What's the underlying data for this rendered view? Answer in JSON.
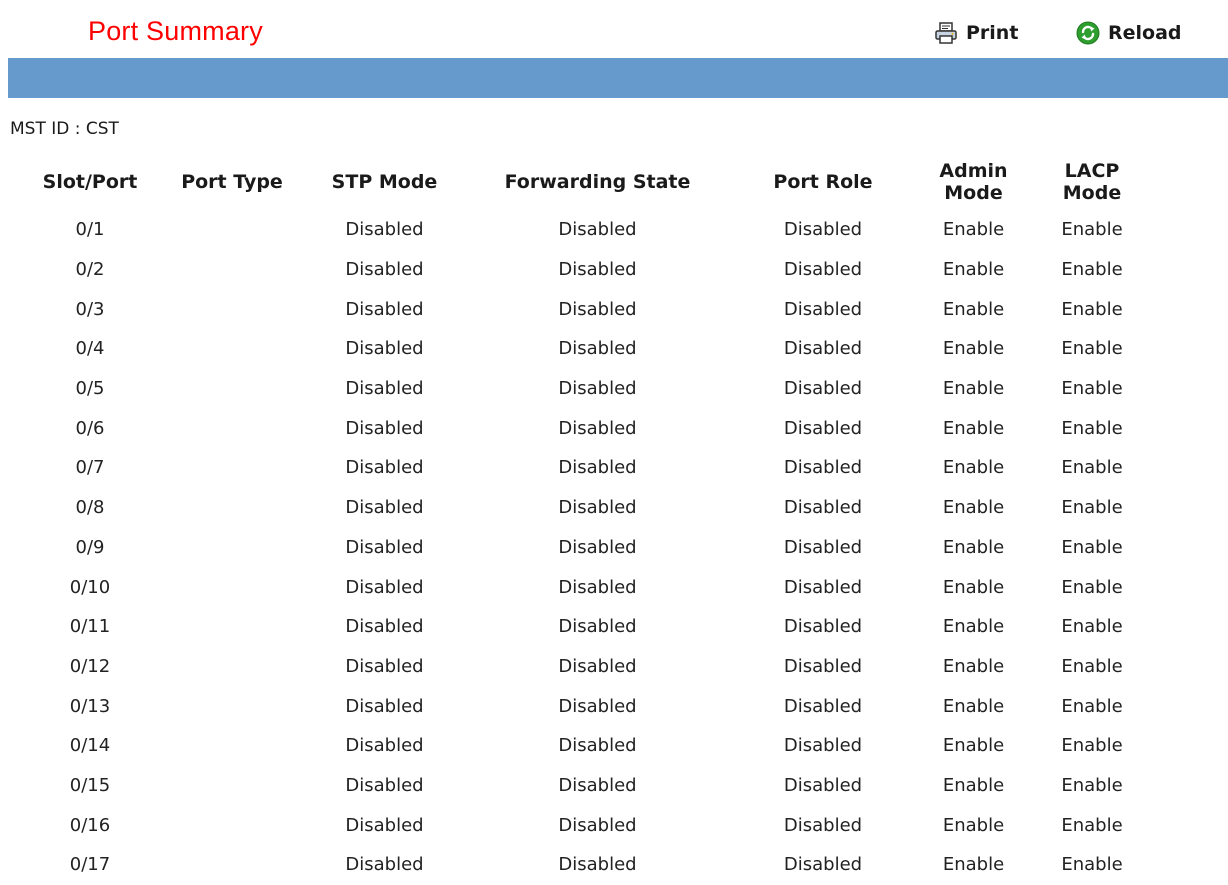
{
  "header": {
    "title": "Port Summary",
    "print_label": "Print",
    "reload_label": "Reload",
    "print_icon": "printer-icon",
    "reload_icon": "refresh-icon"
  },
  "colors": {
    "title": "#ff0000",
    "bar": "#6699cc",
    "reload_icon": "#2e9e2e"
  },
  "mst": {
    "label": "MST ID : CST"
  },
  "table": {
    "headers": {
      "slot_port": "Slot/Port",
      "port_type": "Port Type",
      "stp_mode": "STP Mode",
      "forwarding_state": "Forwarding State",
      "port_role": "Port Role",
      "admin_mode_1": "Admin",
      "admin_mode_2": "Mode",
      "lacp_mode_1": "LACP",
      "lacp_mode_2": "Mode"
    },
    "rows": [
      {
        "slot_port": "0/1",
        "port_type": "",
        "stp_mode": "Disabled",
        "forwarding_state": "Disabled",
        "port_role": "Disabled",
        "admin_mode": "Enable",
        "lacp_mode": "Enable"
      },
      {
        "slot_port": "0/2",
        "port_type": "",
        "stp_mode": "Disabled",
        "forwarding_state": "Disabled",
        "port_role": "Disabled",
        "admin_mode": "Enable",
        "lacp_mode": "Enable"
      },
      {
        "slot_port": "0/3",
        "port_type": "",
        "stp_mode": "Disabled",
        "forwarding_state": "Disabled",
        "port_role": "Disabled",
        "admin_mode": "Enable",
        "lacp_mode": "Enable"
      },
      {
        "slot_port": "0/4",
        "port_type": "",
        "stp_mode": "Disabled",
        "forwarding_state": "Disabled",
        "port_role": "Disabled",
        "admin_mode": "Enable",
        "lacp_mode": "Enable"
      },
      {
        "slot_port": "0/5",
        "port_type": "",
        "stp_mode": "Disabled",
        "forwarding_state": "Disabled",
        "port_role": "Disabled",
        "admin_mode": "Enable",
        "lacp_mode": "Enable"
      },
      {
        "slot_port": "0/6",
        "port_type": "",
        "stp_mode": "Disabled",
        "forwarding_state": "Disabled",
        "port_role": "Disabled",
        "admin_mode": "Enable",
        "lacp_mode": "Enable"
      },
      {
        "slot_port": "0/7",
        "port_type": "",
        "stp_mode": "Disabled",
        "forwarding_state": "Disabled",
        "port_role": "Disabled",
        "admin_mode": "Enable",
        "lacp_mode": "Enable"
      },
      {
        "slot_port": "0/8",
        "port_type": "",
        "stp_mode": "Disabled",
        "forwarding_state": "Disabled",
        "port_role": "Disabled",
        "admin_mode": "Enable",
        "lacp_mode": "Enable"
      },
      {
        "slot_port": "0/9",
        "port_type": "",
        "stp_mode": "Disabled",
        "forwarding_state": "Disabled",
        "port_role": "Disabled",
        "admin_mode": "Enable",
        "lacp_mode": "Enable"
      },
      {
        "slot_port": "0/10",
        "port_type": "",
        "stp_mode": "Disabled",
        "forwarding_state": "Disabled",
        "port_role": "Disabled",
        "admin_mode": "Enable",
        "lacp_mode": "Enable"
      },
      {
        "slot_port": "0/11",
        "port_type": "",
        "stp_mode": "Disabled",
        "forwarding_state": "Disabled",
        "port_role": "Disabled",
        "admin_mode": "Enable",
        "lacp_mode": "Enable"
      },
      {
        "slot_port": "0/12",
        "port_type": "",
        "stp_mode": "Disabled",
        "forwarding_state": "Disabled",
        "port_role": "Disabled",
        "admin_mode": "Enable",
        "lacp_mode": "Enable"
      },
      {
        "slot_port": "0/13",
        "port_type": "",
        "stp_mode": "Disabled",
        "forwarding_state": "Disabled",
        "port_role": "Disabled",
        "admin_mode": "Enable",
        "lacp_mode": "Enable"
      },
      {
        "slot_port": "0/14",
        "port_type": "",
        "stp_mode": "Disabled",
        "forwarding_state": "Disabled",
        "port_role": "Disabled",
        "admin_mode": "Enable",
        "lacp_mode": "Enable"
      },
      {
        "slot_port": "0/15",
        "port_type": "",
        "stp_mode": "Disabled",
        "forwarding_state": "Disabled",
        "port_role": "Disabled",
        "admin_mode": "Enable",
        "lacp_mode": "Enable"
      },
      {
        "slot_port": "0/16",
        "port_type": "",
        "stp_mode": "Disabled",
        "forwarding_state": "Disabled",
        "port_role": "Disabled",
        "admin_mode": "Enable",
        "lacp_mode": "Enable"
      },
      {
        "slot_port": "0/17",
        "port_type": "",
        "stp_mode": "Disabled",
        "forwarding_state": "Disabled",
        "port_role": "Disabled",
        "admin_mode": "Enable",
        "lacp_mode": "Enable"
      }
    ]
  }
}
